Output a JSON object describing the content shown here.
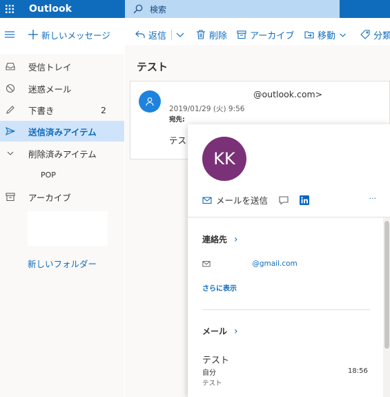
{
  "topbar": {
    "brand": "Outlook",
    "search_placeholder": "検索"
  },
  "commandbar": {
    "new_message": "新しいメッセージ",
    "reply": "返信",
    "delete": "削除",
    "archive": "アーカイブ",
    "move": "移動",
    "categorize": "分類"
  },
  "nav": {
    "items": [
      {
        "label": "受信トレイ",
        "count": ""
      },
      {
        "label": "迷惑メール",
        "count": ""
      },
      {
        "label": "下書き",
        "count": "2"
      },
      {
        "label": "送信済みアイテム",
        "count": ""
      },
      {
        "label": "削除済みアイテム",
        "count": ""
      },
      {
        "label": "POP",
        "count": ""
      },
      {
        "label": "アーカイブ",
        "count": ""
      }
    ],
    "new_folder": "新しいフォルダー"
  },
  "reading": {
    "subject": "テスト",
    "from_address": "@outlook.com>",
    "date": "2019/01/29 (火) 9:56",
    "to_label": "宛先:",
    "body": "テスト"
  },
  "contact_card": {
    "initials": "KK",
    "avatar_color": "#7b3177",
    "send_email": "メールを送信",
    "more": "···",
    "contact_heading": "連絡先",
    "email": "@gmail.com",
    "show_more": "さらに表示",
    "mail_heading": "メール",
    "mail_subject": "テスト",
    "mail_from": "自分",
    "mail_time": "18:56",
    "mail_preview": "テスト"
  },
  "colors": {
    "brand": "#0f6cbd",
    "search_bg": "#b9d8f4",
    "selected_bg": "#cfe4fa",
    "sender_avatar": "#1e83de"
  }
}
